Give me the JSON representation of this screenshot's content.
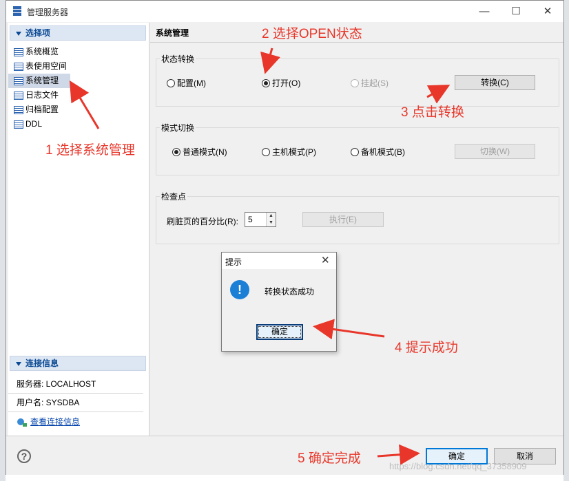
{
  "window": {
    "title": "管理服务器",
    "minimize_glyph": "—",
    "maximize_glyph": "☐",
    "close_glyph": "✕"
  },
  "sidebar": {
    "section_title": "选择项",
    "items": [
      {
        "label": "系统概览",
        "icon": "list-icon"
      },
      {
        "label": "表使用空间",
        "icon": "list-icon"
      },
      {
        "label": "系统管理",
        "icon": "list-icon",
        "selected": true
      },
      {
        "label": "日志文件",
        "icon": "list-icon"
      },
      {
        "label": "归档配置",
        "icon": "list-icon"
      },
      {
        "label": "DDL",
        "icon": "list-icon"
      }
    ],
    "connection": {
      "section_title": "连接信息",
      "server": "服务器: LOCALHOST",
      "user": "用户名: SYSDBA",
      "view_link": "查看连接信息"
    }
  },
  "main": {
    "title": "系统管理",
    "state_group": {
      "label": "状态转换",
      "options": [
        {
          "label": "配置(M)",
          "checked": false,
          "enabled": true
        },
        {
          "label": "打开(O)",
          "checked": true,
          "enabled": true
        },
        {
          "label": "挂起(S)",
          "checked": false,
          "enabled": false
        }
      ],
      "button": "转换(C)"
    },
    "mode_group": {
      "label": "模式切换",
      "options": [
        {
          "label": "普通模式(N)",
          "checked": true
        },
        {
          "label": "主机模式(P)",
          "checked": false
        },
        {
          "label": "备机模式(B)",
          "checked": false
        }
      ],
      "button": "切换(W)"
    },
    "checkpoint_group": {
      "label": "检查点",
      "field_label": "刷脏页的百分比(R):",
      "field_value": "5",
      "button": "执行(E)"
    }
  },
  "popup": {
    "title": "提示",
    "close_glyph": "✕",
    "icon_glyph": "!",
    "message": "转换状态成功",
    "ok": "确定"
  },
  "footer": {
    "help_glyph": "?",
    "ok": "确定",
    "cancel": "取消"
  },
  "annotations": {
    "step1": "1 选择系统管理",
    "step2": "2 选择OPEN状态",
    "step3": "3 点击转换",
    "step4": "4 提示成功",
    "step5": "5 确定完成",
    "color": "#e8362a"
  },
  "watermark": "https://blog.csdn.net/qq_37358909"
}
